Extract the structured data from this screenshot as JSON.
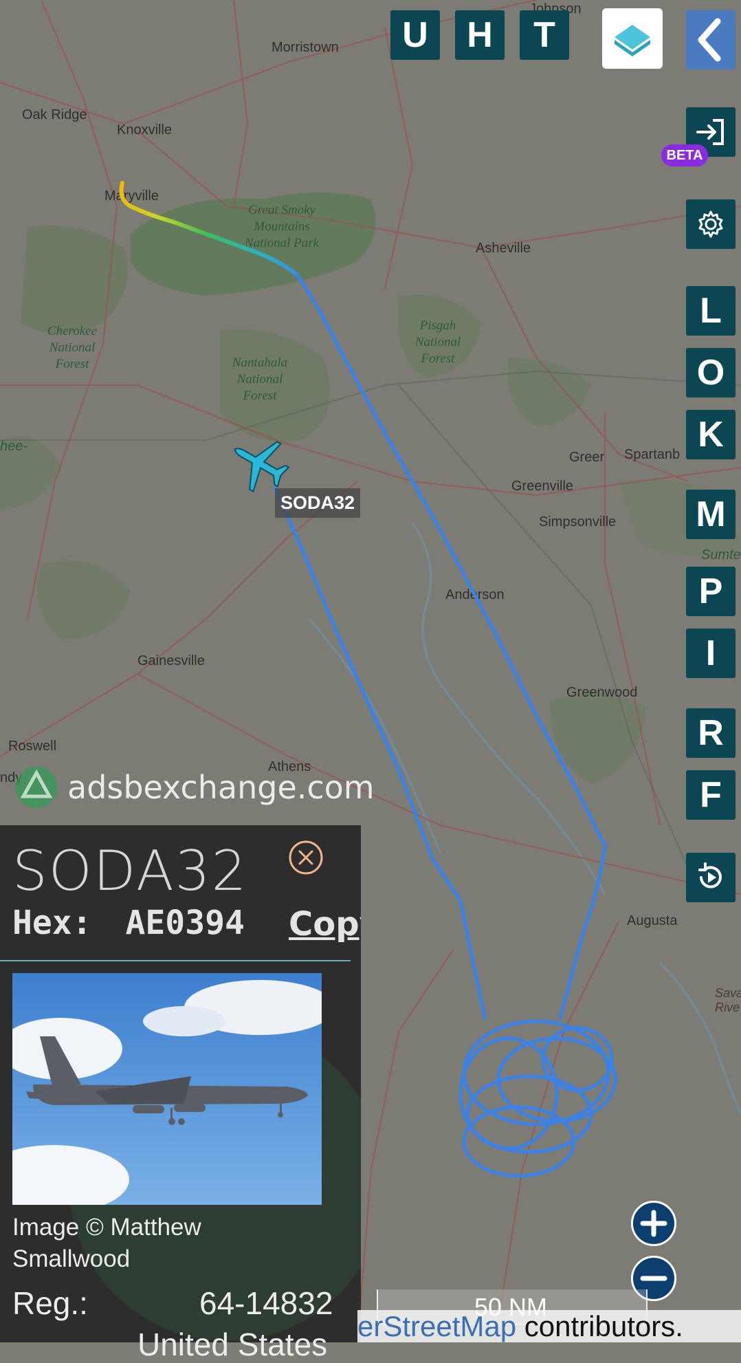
{
  "map": {
    "cities": [
      {
        "name": "Morristown"
      },
      {
        "name": "Oak Ridge"
      },
      {
        "name": "Knoxville"
      },
      {
        "name": "Maryville"
      },
      {
        "name": "Asheville"
      },
      {
        "name": "Greer"
      },
      {
        "name": "Spartanb"
      },
      {
        "name": "Greenville"
      },
      {
        "name": "Simpsonville"
      },
      {
        "name": "Anderson"
      },
      {
        "name": "Gainesville"
      },
      {
        "name": "Greenwood"
      },
      {
        "name": "Roswell"
      },
      {
        "name": "Athens"
      },
      {
        "name": "Augusta"
      },
      {
        "name": "Johnson"
      },
      {
        "name": "Sumte"
      },
      {
        "name": "Sava Rive"
      },
      {
        "name": "hee-"
      },
      {
        "name": "ndy"
      }
    ],
    "parks": [
      {
        "name": "Great Smoky Mountains National Park"
      },
      {
        "name": "Cherokee National Forest"
      },
      {
        "name": "Nantahala National Forest"
      },
      {
        "name": "Pisgah National Forest"
      }
    ],
    "aircraft_label": "SODA32",
    "watermark": "adsbexchange.com",
    "scale": "50 NM",
    "attribution": {
      "prefix": "erStreetMap",
      "suffix": " contributors."
    }
  },
  "toolbar": {
    "top_buttons": [
      "U",
      "H",
      "T"
    ],
    "side_buttons": [
      "L",
      "O",
      "K",
      "M",
      "P",
      "I",
      "R",
      "F"
    ],
    "beta_badge": "BETA",
    "icons": [
      "layers-icon",
      "back-chevron-icon",
      "login-icon",
      "gear-icon",
      "replay-icon",
      "zoom-in-icon",
      "zoom-out-icon"
    ]
  },
  "panel": {
    "callsign": "SODA32",
    "hex_label": "Hex:",
    "hex_value": "AE0394",
    "copy_label": "Copy",
    "image_credit": "Image © Matthew Smallwood",
    "reg_label": "Reg.:",
    "reg_value": "64-14832",
    "country": "United States"
  },
  "colors": {
    "button_bg": "#0c4652",
    "track": "#3b82e8",
    "beta": "#8a2be2",
    "panel_bg": "#2d2d2d",
    "close": "#f3b58a"
  }
}
